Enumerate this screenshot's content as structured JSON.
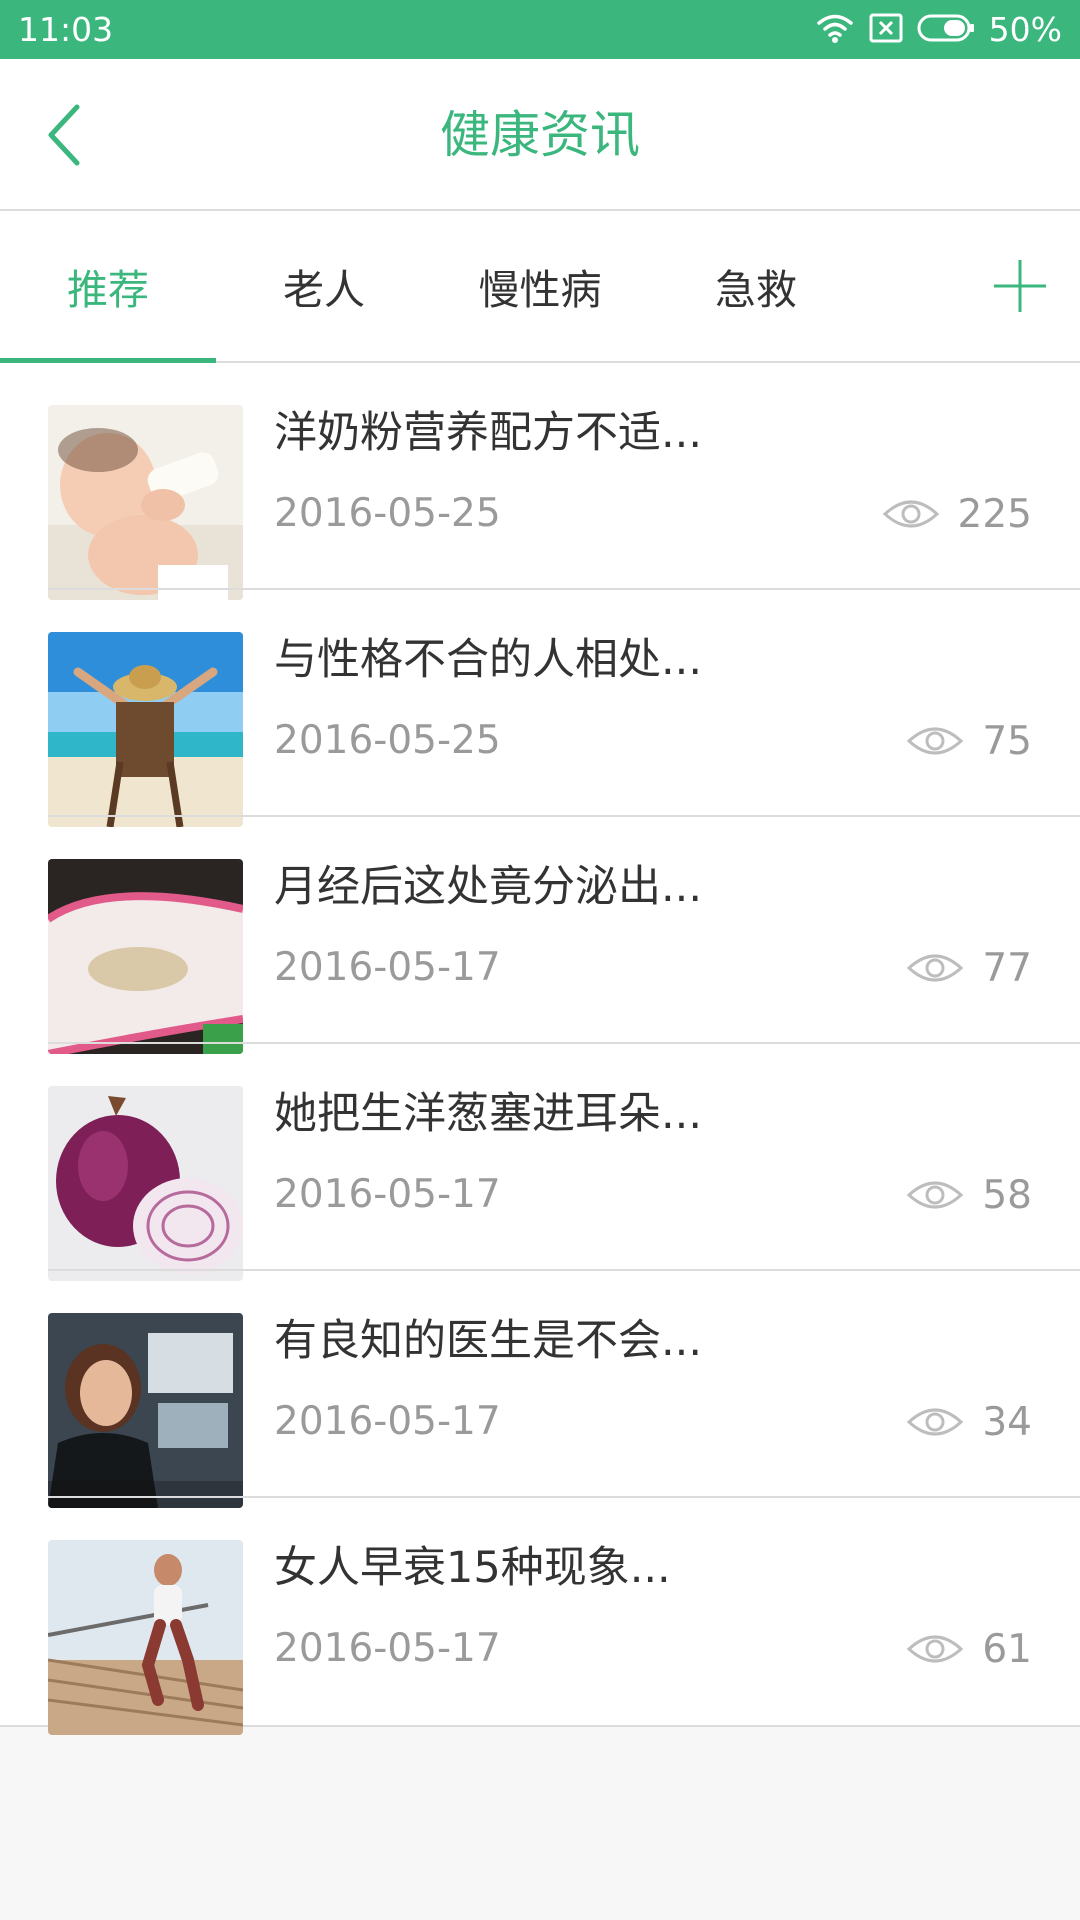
{
  "status_bar": {
    "time": "11:03",
    "battery": "50%"
  },
  "header": {
    "title": "健康资讯"
  },
  "tabs": [
    {
      "label": "推荐",
      "active": true
    },
    {
      "label": "老人",
      "active": false
    },
    {
      "label": "慢性病",
      "active": false
    },
    {
      "label": "急救",
      "active": false
    }
  ],
  "articles": [
    {
      "title": "洋奶粉营养配方不适...",
      "date": "2016-05-25",
      "views": "225",
      "thumb_icon": "baby-bottle-photo"
    },
    {
      "title": "与性格不合的人相处...",
      "date": "2016-05-25",
      "views": "75",
      "thumb_icon": "beach-chair-photo"
    },
    {
      "title": "月经后这处竟分泌出...",
      "date": "2016-05-17",
      "views": "77",
      "thumb_icon": "underwear-photo"
    },
    {
      "title": "她把生洋葱塞进耳朵...",
      "date": "2016-05-17",
      "views": "58",
      "thumb_icon": "red-onion-photo"
    },
    {
      "title": "有良知的医生是不会...",
      "date": "2016-05-17",
      "views": "34",
      "thumb_icon": "doctor-video-photo"
    },
    {
      "title": "女人早衰15种现象...",
      "date": "2016-05-17",
      "views": "61",
      "thumb_icon": "runner-stairs-photo"
    }
  ],
  "colors": {
    "accent": "#3bb77e",
    "text": "#333333",
    "muted": "#9a9a9a"
  }
}
